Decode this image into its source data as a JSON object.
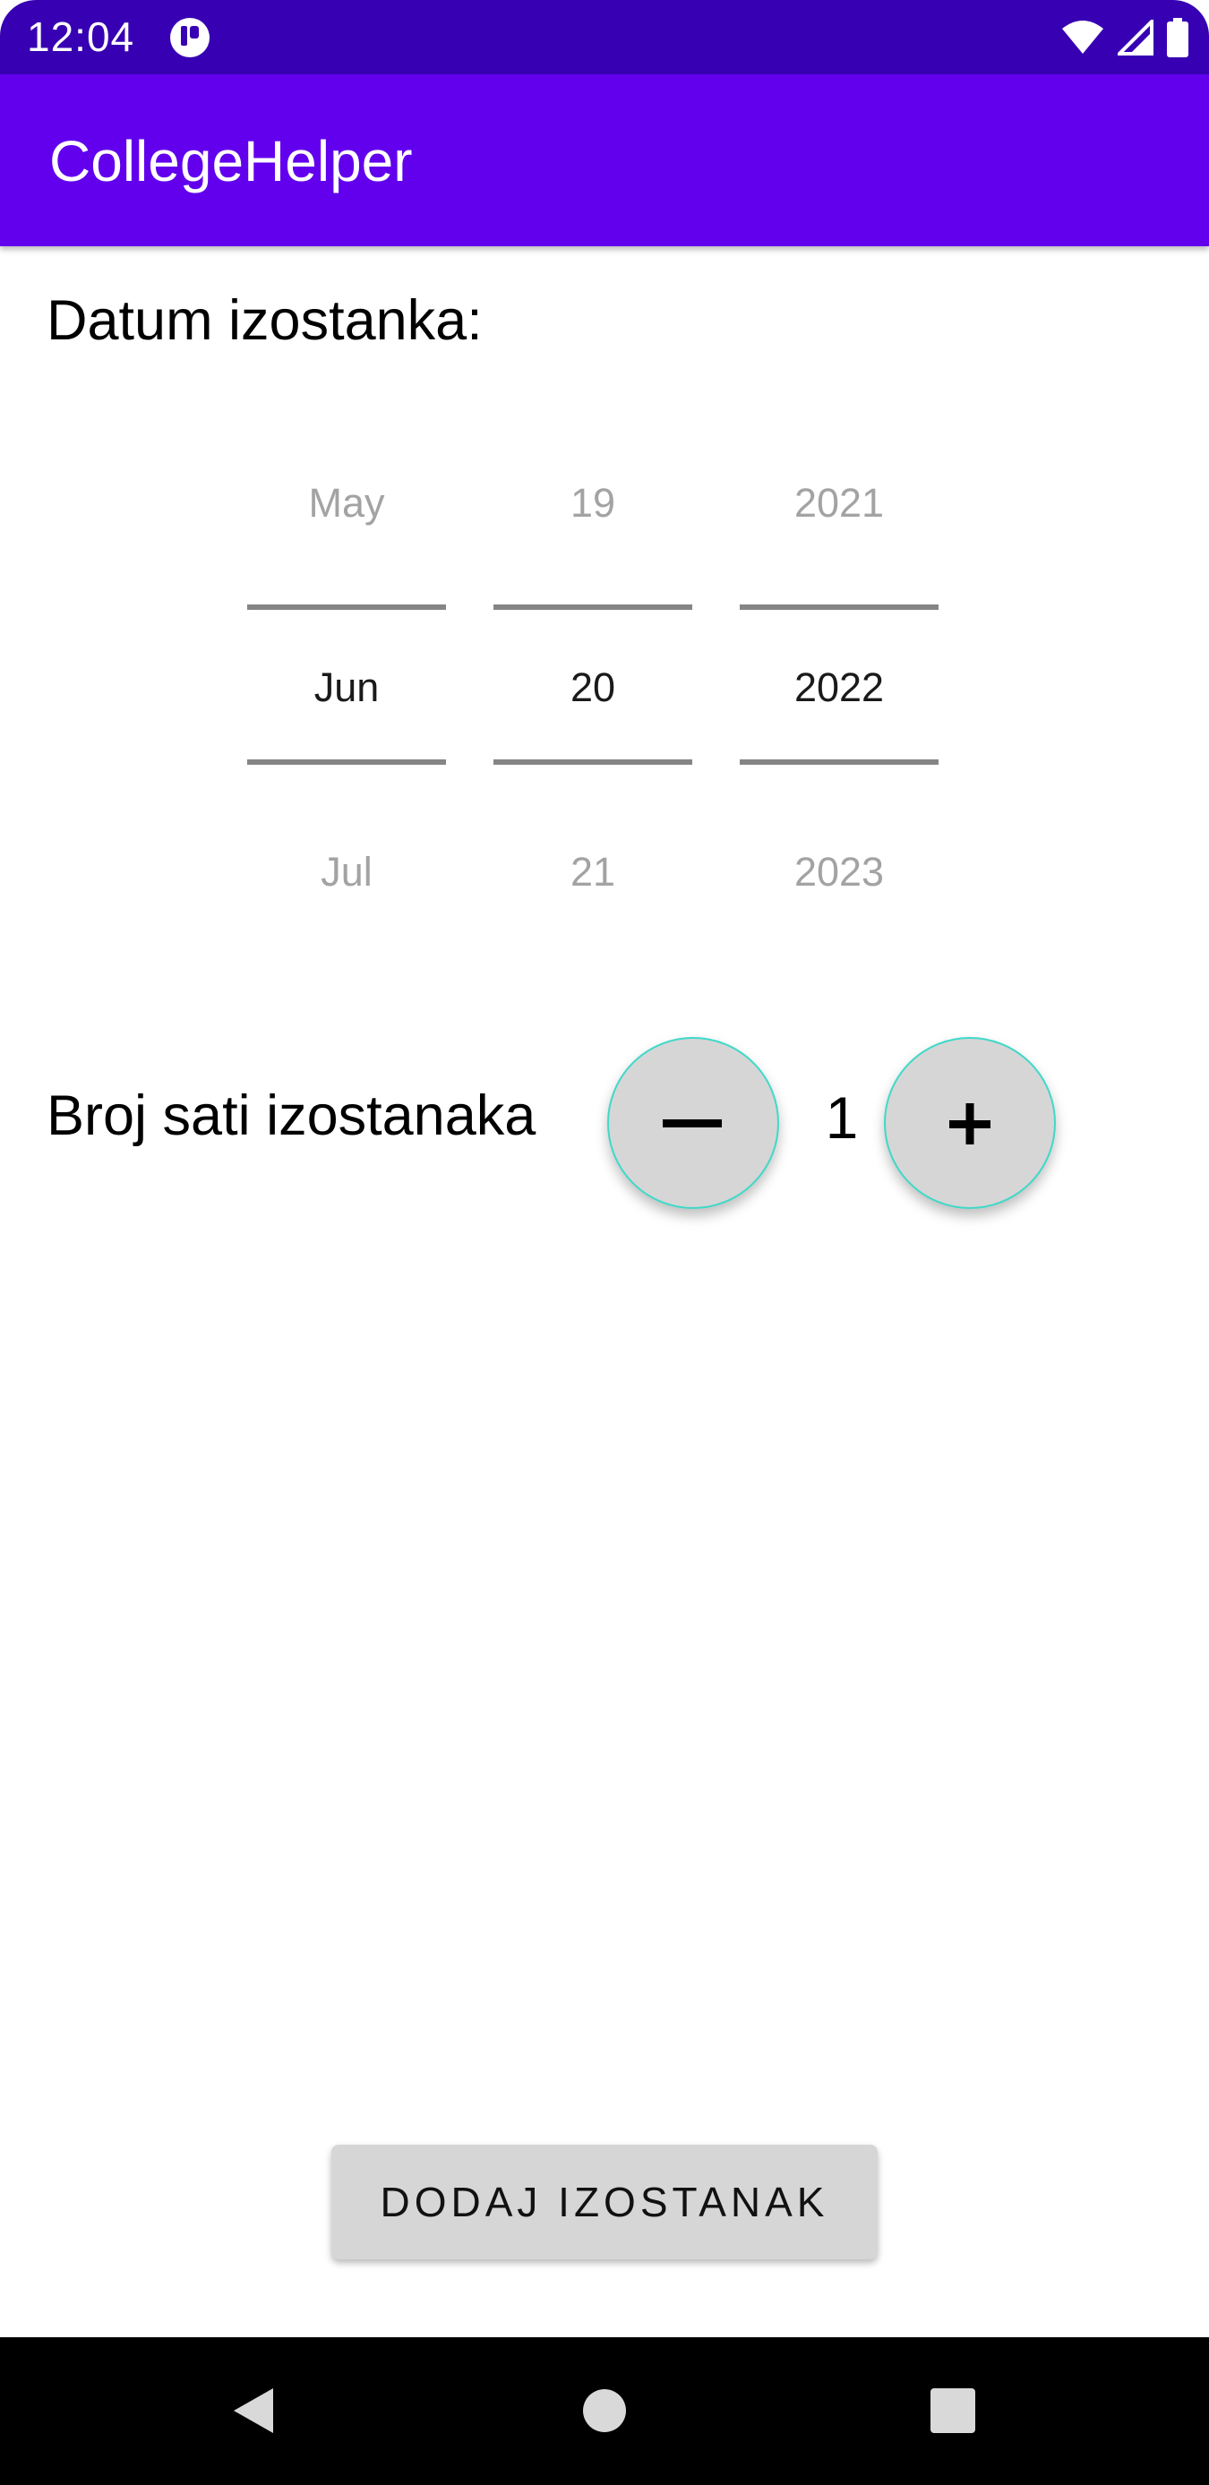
{
  "status_bar": {
    "time": "12:04",
    "icons": [
      "app-notification-icon",
      "wifi-icon",
      "signal-icon",
      "battery-icon"
    ],
    "background": "#3700b3"
  },
  "app_bar": {
    "title": "CollegeHelper",
    "background": "#6200ee"
  },
  "date_section": {
    "label": "Datum izostanka:",
    "months": {
      "prev": "May",
      "selected": "Jun",
      "next": "Jul"
    },
    "days": {
      "prev": "19",
      "selected": "20",
      "next": "21"
    },
    "years": {
      "prev": "2021",
      "selected": "2022",
      "next": "2023"
    }
  },
  "hours_section": {
    "label": "Broj sati izostanaka",
    "value": "1",
    "decrement_icon": "minus-icon",
    "increment_icon": "plus-icon"
  },
  "add_button": {
    "label": "DODAJ IZOSTANAK"
  },
  "nav_bar": {
    "icons": [
      "back-icon",
      "home-icon",
      "recents-icon"
    ]
  }
}
